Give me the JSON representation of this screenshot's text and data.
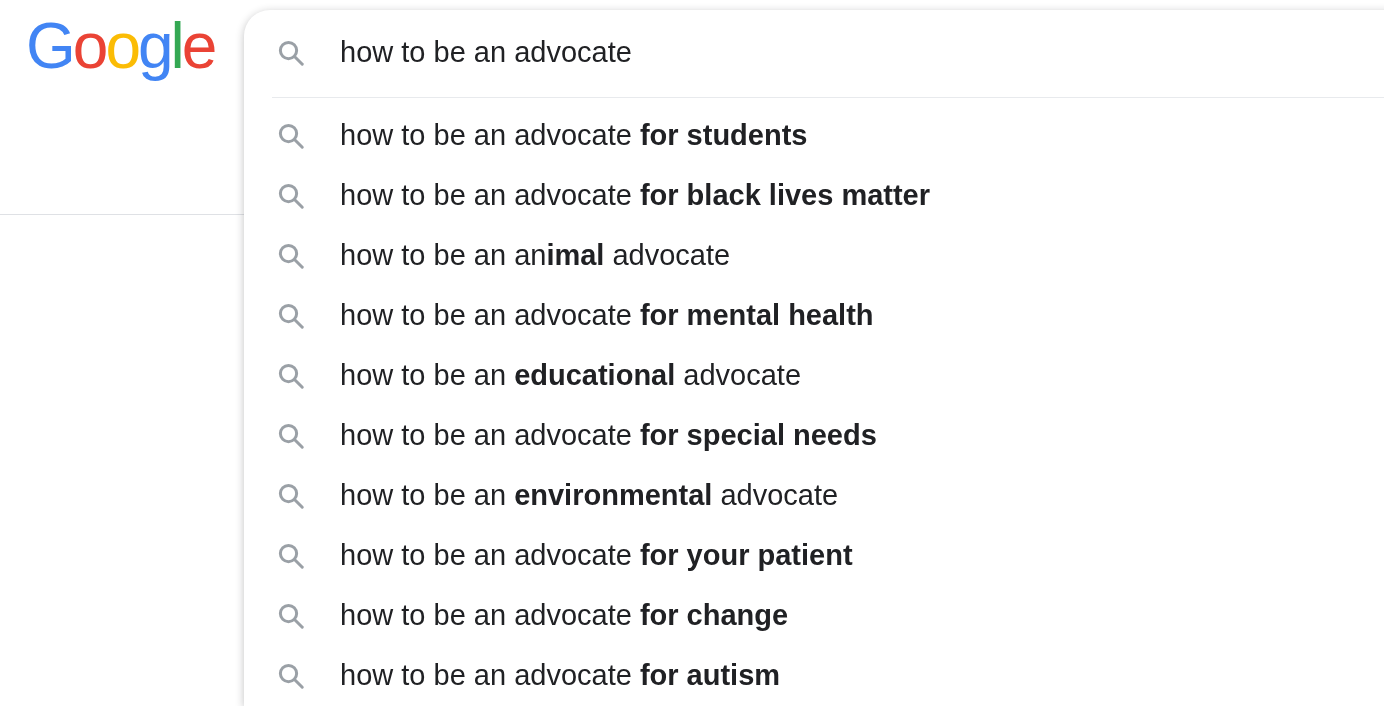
{
  "logo": {
    "letters": [
      {
        "text": "G",
        "color": "#4285f4"
      },
      {
        "text": "o",
        "color": "#ea4335"
      },
      {
        "text": "o",
        "color": "#fbbc05"
      },
      {
        "text": "g",
        "color": "#4285f4"
      },
      {
        "text": "l",
        "color": "#34a853"
      },
      {
        "text": "e",
        "color": "#ea4335"
      }
    ]
  },
  "search": {
    "value": "how to be an advocate"
  },
  "suggestions": [
    {
      "text": "how to be an advocate **for students**"
    },
    {
      "text": "how to be an advocate **for black lives matter**"
    },
    {
      "text": "how to be an an**imal** advocate"
    },
    {
      "text": "how to be an advocate **for mental health**"
    },
    {
      "text": "how to be an **educational** advocate"
    },
    {
      "text": "how to be an advocate **for special needs**"
    },
    {
      "text": "how to be an **environmental** advocate"
    },
    {
      "text": "how to be an advocate **for your patient**"
    },
    {
      "text": "how to be an advocate **for change**"
    },
    {
      "text": "how to be an advocate **for autism**"
    }
  ]
}
